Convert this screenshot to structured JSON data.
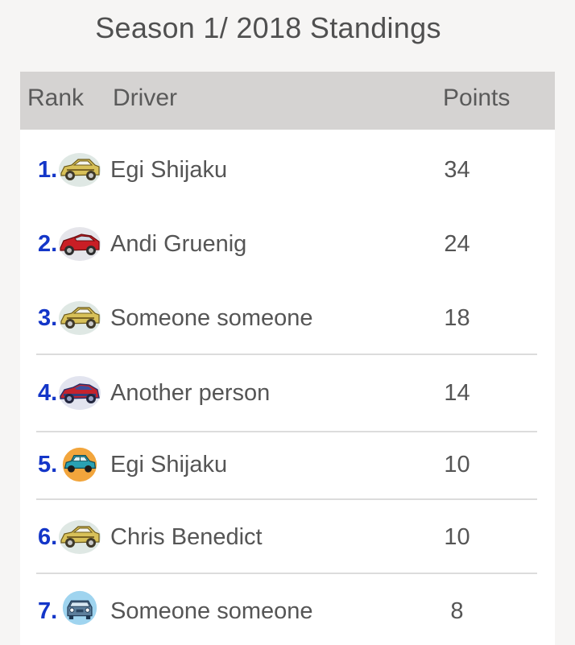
{
  "title": "Season 1/ 2018 Standings",
  "header": {
    "rank": "Rank",
    "driver": "Driver",
    "points": "Points"
  },
  "rows": [
    {
      "rank": "1",
      "driver": "Egi Shijaku",
      "points": "34",
      "icon": "yellow-sports-car-icon"
    },
    {
      "rank": "2",
      "driver": "Andi Gruenig",
      "points": "24",
      "icon": "red-sports-car-icon"
    },
    {
      "rank": "3",
      "driver": "Someone someone",
      "points": "18",
      "icon": "yellow-sports-car-icon"
    },
    {
      "rank": "4",
      "driver": "Another person",
      "points": "14",
      "icon": "red-blue-car-icon"
    },
    {
      "rank": "5",
      "driver": "Egi Shijaku",
      "points": "10",
      "icon": "teal-mini-car-icon"
    },
    {
      "rank": "6",
      "driver": "Chris Benedict",
      "points": "10",
      "icon": "yellow-sports-car-icon"
    },
    {
      "rank": "7",
      "driver": "Someone someone",
      "points": "8",
      "icon": "blue-car-front-icon"
    }
  ],
  "colors": {
    "rank": "#1436c8",
    "header_bg": "#d5d3d2",
    "page_bg": "#f6f5f4",
    "text": "#555555"
  }
}
